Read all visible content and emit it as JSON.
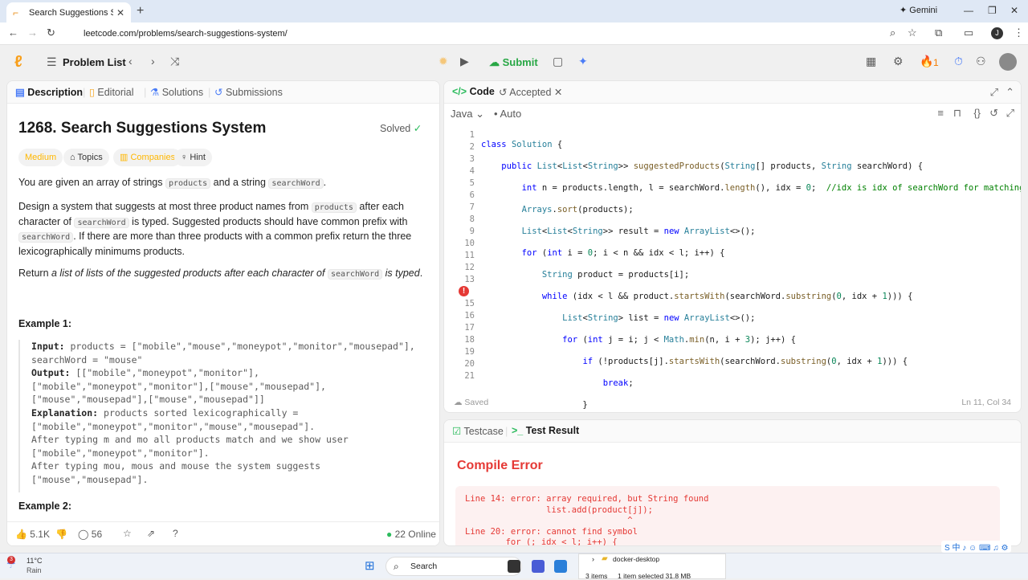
{
  "browser": {
    "tab_title": "Search Suggestions System - Le",
    "url": "leetcode.com/problems/search-suggestions-system/",
    "gemini_label": "Gemini",
    "profile_initial": "J"
  },
  "header": {
    "problem_list": "Problem List",
    "submit": "Submit",
    "streak": "1"
  },
  "left": {
    "tabs": [
      "Description",
      "Editorial",
      "Solutions",
      "Submissions"
    ],
    "title": "1268. Search Suggestions System",
    "solved": "Solved",
    "pills": [
      "Medium",
      "Topics",
      "Companies",
      "Hint"
    ],
    "p1_a": "You are given an array of strings ",
    "p1_code1": "products",
    "p1_b": " and a string ",
    "p1_code2": "searchWord",
    "p1_c": ".",
    "p2_a": "Design a system that suggests at most three product names from ",
    "p2_code1": "products",
    "p2_b": " after each character of ",
    "p2_code2": "searchWord",
    "p2_c": " is typed. Suggested products should have common prefix with ",
    "p2_code3": "searchWord",
    "p2_d": ". If there are more than three products with a common prefix return the three lexicographically minimums products.",
    "p3_a": "Return ",
    "p3_em": "a list of lists of the suggested products after each character of ",
    "p3_code": "searchWord",
    "p3_em2": " is typed",
    "p3_c": ".",
    "example1": "Example 1:",
    "ex_input_label": "Input:",
    "ex_input": " products = [\"mobile\",\"mouse\",\"moneypot\",\"monitor\",\"mousepad\"],\nsearchWord = \"mouse\"",
    "ex_output_label": "Output:",
    "ex_output": " [[\"mobile\",\"moneypot\",\"monitor\"],\n[\"mobile\",\"moneypot\",\"monitor\"],[\"mouse\",\"mousepad\"],\n[\"mouse\",\"mousepad\"],[\"mouse\",\"mousepad\"]]",
    "ex_expl_label": "Explanation:",
    "ex_expl": " products sorted lexicographically =\n[\"mobile\",\"moneypot\",\"monitor\",\"mouse\",\"mousepad\"].\nAfter typing m and mo all products match and we show user\n[\"mobile\",\"moneypot\",\"monitor\"].\nAfter typing mou, mous and mouse the system suggests\n[\"mouse\",\"mousepad\"].",
    "example2": "Example 2:",
    "likes": "5.1K",
    "comments": "56",
    "online": "22 Online"
  },
  "code": {
    "tab_code": "Code",
    "tab_accepted": "Accepted",
    "language": "Java",
    "auto": "Auto",
    "line_numbers": [
      "1",
      "2",
      "3",
      "4",
      "5",
      "6",
      "7",
      "8",
      "9",
      "10",
      "11",
      "12",
      "13",
      "14",
      "15",
      "16",
      "17",
      "18",
      "19",
      "20",
      "21"
    ],
    "error_line": "14",
    "saved": "Saved",
    "cursor": "Ln 11, Col 34"
  },
  "test": {
    "tab_testcase": "Testcase",
    "tab_result": "Test Result",
    "status": "Compile Error",
    "errors": "Line 14: error: array required, but String found\n                list.add(product[j]);\n                                ^\nLine 20: error: cannot find symbol\n        for (; idx < l; i++) {"
  },
  "taskbar": {
    "weather_temp": "11°C",
    "weather_desc": "Rain",
    "notif": "3",
    "search": "Search",
    "explorer_folder": "docker-desktop",
    "explorer_items": "3 items",
    "explorer_selected": "1 item selected  31.8 MB"
  }
}
